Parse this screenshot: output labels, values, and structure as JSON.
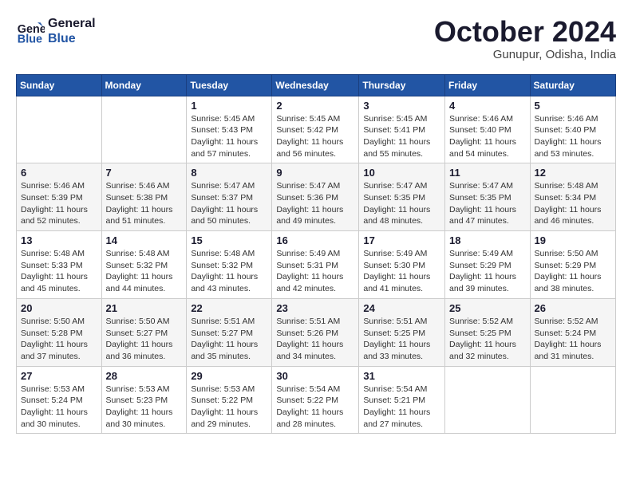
{
  "logo": {
    "line1": "General",
    "line2": "Blue"
  },
  "title": "October 2024",
  "location": "Gunupur, Odisha, India",
  "days_of_week": [
    "Sunday",
    "Monday",
    "Tuesday",
    "Wednesday",
    "Thursday",
    "Friday",
    "Saturday"
  ],
  "weeks": [
    [
      {
        "day": "",
        "info": ""
      },
      {
        "day": "",
        "info": ""
      },
      {
        "day": "1",
        "info": "Sunrise: 5:45 AM\nSunset: 5:43 PM\nDaylight: 11 hours\nand 57 minutes."
      },
      {
        "day": "2",
        "info": "Sunrise: 5:45 AM\nSunset: 5:42 PM\nDaylight: 11 hours\nand 56 minutes."
      },
      {
        "day": "3",
        "info": "Sunrise: 5:45 AM\nSunset: 5:41 PM\nDaylight: 11 hours\nand 55 minutes."
      },
      {
        "day": "4",
        "info": "Sunrise: 5:46 AM\nSunset: 5:40 PM\nDaylight: 11 hours\nand 54 minutes."
      },
      {
        "day": "5",
        "info": "Sunrise: 5:46 AM\nSunset: 5:40 PM\nDaylight: 11 hours\nand 53 minutes."
      }
    ],
    [
      {
        "day": "6",
        "info": "Sunrise: 5:46 AM\nSunset: 5:39 PM\nDaylight: 11 hours\nand 52 minutes."
      },
      {
        "day": "7",
        "info": "Sunrise: 5:46 AM\nSunset: 5:38 PM\nDaylight: 11 hours\nand 51 minutes."
      },
      {
        "day": "8",
        "info": "Sunrise: 5:47 AM\nSunset: 5:37 PM\nDaylight: 11 hours\nand 50 minutes."
      },
      {
        "day": "9",
        "info": "Sunrise: 5:47 AM\nSunset: 5:36 PM\nDaylight: 11 hours\nand 49 minutes."
      },
      {
        "day": "10",
        "info": "Sunrise: 5:47 AM\nSunset: 5:35 PM\nDaylight: 11 hours\nand 48 minutes."
      },
      {
        "day": "11",
        "info": "Sunrise: 5:47 AM\nSunset: 5:35 PM\nDaylight: 11 hours\nand 47 minutes."
      },
      {
        "day": "12",
        "info": "Sunrise: 5:48 AM\nSunset: 5:34 PM\nDaylight: 11 hours\nand 46 minutes."
      }
    ],
    [
      {
        "day": "13",
        "info": "Sunrise: 5:48 AM\nSunset: 5:33 PM\nDaylight: 11 hours\nand 45 minutes."
      },
      {
        "day": "14",
        "info": "Sunrise: 5:48 AM\nSunset: 5:32 PM\nDaylight: 11 hours\nand 44 minutes."
      },
      {
        "day": "15",
        "info": "Sunrise: 5:48 AM\nSunset: 5:32 PM\nDaylight: 11 hours\nand 43 minutes."
      },
      {
        "day": "16",
        "info": "Sunrise: 5:49 AM\nSunset: 5:31 PM\nDaylight: 11 hours\nand 42 minutes."
      },
      {
        "day": "17",
        "info": "Sunrise: 5:49 AM\nSunset: 5:30 PM\nDaylight: 11 hours\nand 41 minutes."
      },
      {
        "day": "18",
        "info": "Sunrise: 5:49 AM\nSunset: 5:29 PM\nDaylight: 11 hours\nand 39 minutes."
      },
      {
        "day": "19",
        "info": "Sunrise: 5:50 AM\nSunset: 5:29 PM\nDaylight: 11 hours\nand 38 minutes."
      }
    ],
    [
      {
        "day": "20",
        "info": "Sunrise: 5:50 AM\nSunset: 5:28 PM\nDaylight: 11 hours\nand 37 minutes."
      },
      {
        "day": "21",
        "info": "Sunrise: 5:50 AM\nSunset: 5:27 PM\nDaylight: 11 hours\nand 36 minutes."
      },
      {
        "day": "22",
        "info": "Sunrise: 5:51 AM\nSunset: 5:27 PM\nDaylight: 11 hours\nand 35 minutes."
      },
      {
        "day": "23",
        "info": "Sunrise: 5:51 AM\nSunset: 5:26 PM\nDaylight: 11 hours\nand 34 minutes."
      },
      {
        "day": "24",
        "info": "Sunrise: 5:51 AM\nSunset: 5:25 PM\nDaylight: 11 hours\nand 33 minutes."
      },
      {
        "day": "25",
        "info": "Sunrise: 5:52 AM\nSunset: 5:25 PM\nDaylight: 11 hours\nand 32 minutes."
      },
      {
        "day": "26",
        "info": "Sunrise: 5:52 AM\nSunset: 5:24 PM\nDaylight: 11 hours\nand 31 minutes."
      }
    ],
    [
      {
        "day": "27",
        "info": "Sunrise: 5:53 AM\nSunset: 5:24 PM\nDaylight: 11 hours\nand 30 minutes."
      },
      {
        "day": "28",
        "info": "Sunrise: 5:53 AM\nSunset: 5:23 PM\nDaylight: 11 hours\nand 30 minutes."
      },
      {
        "day": "29",
        "info": "Sunrise: 5:53 AM\nSunset: 5:22 PM\nDaylight: 11 hours\nand 29 minutes."
      },
      {
        "day": "30",
        "info": "Sunrise: 5:54 AM\nSunset: 5:22 PM\nDaylight: 11 hours\nand 28 minutes."
      },
      {
        "day": "31",
        "info": "Sunrise: 5:54 AM\nSunset: 5:21 PM\nDaylight: 11 hours\nand 27 minutes."
      },
      {
        "day": "",
        "info": ""
      },
      {
        "day": "",
        "info": ""
      }
    ]
  ]
}
